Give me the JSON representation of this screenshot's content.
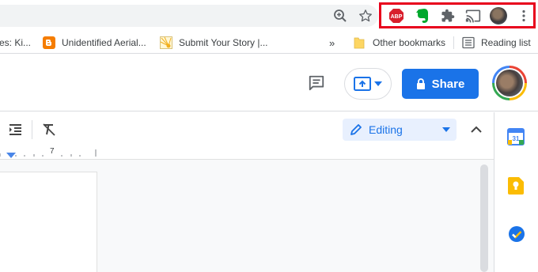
{
  "extensions": {
    "abp_label": "ABP",
    "icons": [
      "zoom-icon",
      "star-icon",
      "adblock-plus-icon",
      "evernote-icon",
      "puzzle-icon",
      "cast-icon",
      "avatar",
      "menu-dots-icon"
    ]
  },
  "bookmarks": {
    "items": [
      {
        "label": "es: Ki..."
      },
      {
        "label": "Unidentified Aerial..."
      },
      {
        "label": "Submit Your Story |..."
      }
    ],
    "overflow": "»",
    "other_label": "Other bookmarks",
    "reading_label": "Reading list"
  },
  "header": {
    "share_label": "Share"
  },
  "format_bar": {
    "mode_label": "Editing"
  },
  "ruler": {
    "mark": "7"
  },
  "side_panel": {
    "calendar_day": "31"
  },
  "colors": {
    "accent": "#1a73e8",
    "highlight": "#e8001c",
    "abp": "#d81f2c",
    "evernote": "#00a82d",
    "blogger": "#f57d00",
    "keep": "#fbbc04",
    "folder": "#fdd663"
  }
}
